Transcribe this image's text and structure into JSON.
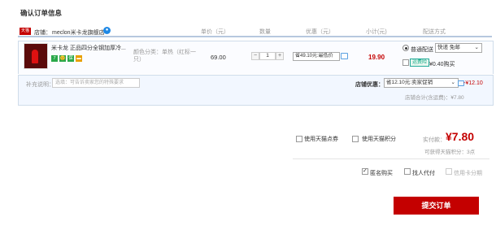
{
  "page_title": "确认订单信息",
  "columns": {
    "price": "单价（元）",
    "qty": "数量",
    "promo": "优惠（元）",
    "subtotal": "小计(元)",
    "shipping": "配送方式"
  },
  "shop": {
    "label": "店铺：",
    "name": "meclon米卡龙旗舰店",
    "logo_text": "天猫"
  },
  "product": {
    "title": "米卡龙 正品四分全钢加厚冷...",
    "sku": "颜色分类：单热（红标一只）",
    "price": "69.00",
    "qty": "1",
    "promo": "省49.10元:最低价",
    "subtotal": "19.90",
    "badges": [
      {
        "text": "7",
        "color": "#2aa84a"
      },
      {
        "text": "😊",
        "color": "#2aa84a"
      },
      {
        "text": "保",
        "color": "#2aa84a"
      },
      {
        "text": "▬",
        "color": "#e8a000"
      }
    ]
  },
  "shipping": {
    "method": "普通配送",
    "option": "快递 免邮",
    "insurance_label": "运费险",
    "insurance_price": "¥0.40购买"
  },
  "memo": {
    "label": "补充说明：",
    "placeholder": "选填：可告诉卖家您的特殊要求"
  },
  "shop_discount": {
    "label": "店铺优惠：",
    "option": "省12.10元:卖家促销",
    "amount": "-¥12.10"
  },
  "shop_total": "店铺合计(含运费)：¥7.80",
  "options": {
    "coupon": "使用天猫点券",
    "points": "使用天猫积分"
  },
  "real_pay": {
    "label": "实付款：",
    "value": "¥7.80"
  },
  "earn_points": "可获得天猫积分：3点",
  "extras": {
    "anonymous": "匿名购买",
    "proxy": "找人代付",
    "credit": "信用卡分期"
  },
  "submit_label": "提交订单"
}
